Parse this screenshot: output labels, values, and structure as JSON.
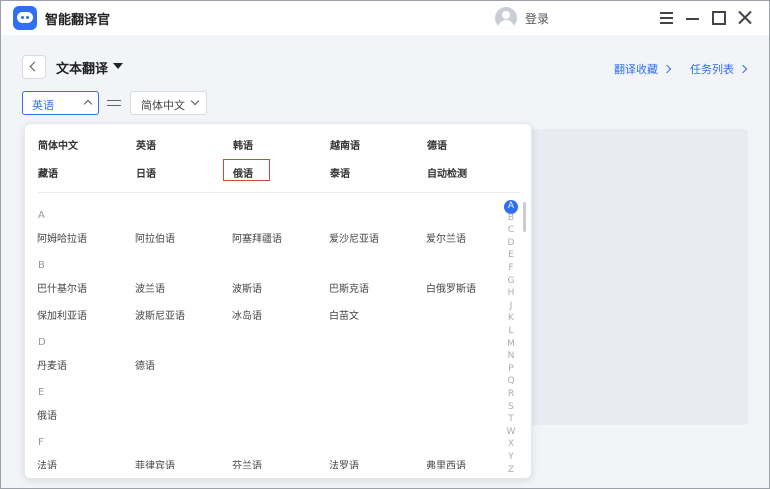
{
  "app": {
    "title": "智能翻译官",
    "login": "登录"
  },
  "header": {
    "mode": "文本翻译",
    "favorites": "翻译收藏",
    "tasks": "任务列表"
  },
  "selectors": {
    "source": "英语",
    "target": "简体中文"
  },
  "dropdown": {
    "common": [
      "简体中文",
      "英语",
      "韩语",
      "越南语",
      "德语",
      "藏语",
      "日语",
      "俄语",
      "泰语",
      "自动检测"
    ],
    "selected": "俄语",
    "groups": [
      {
        "letter": "A",
        "items": [
          "阿姆哈拉语",
          "阿拉伯语",
          "阿塞拜疆语",
          "爱沙尼亚语",
          "爱尔兰语"
        ]
      },
      {
        "letter": "B",
        "items": [
          "巴什基尔语",
          "波兰语",
          "波斯语",
          "巴斯克语",
          "白俄罗斯语",
          "保加利亚语",
          "波斯尼亚语",
          "冰岛语",
          "白苗文"
        ]
      },
      {
        "letter": "D",
        "items": [
          "丹麦语",
          "德语"
        ]
      },
      {
        "letter": "E",
        "items": [
          "俄语"
        ]
      },
      {
        "letter": "F",
        "items": [
          "法语",
          "菲律宾语",
          "芬兰语",
          "法罗语",
          "弗里西语"
        ]
      }
    ],
    "alphabet": [
      "A",
      "B",
      "C",
      "D",
      "E",
      "F",
      "G",
      "H",
      "J",
      "K",
      "L",
      "M",
      "N",
      "P",
      "Q",
      "R",
      "S",
      "T",
      "W",
      "X",
      "Y",
      "Z"
    ],
    "active_letter": "A"
  },
  "colors": {
    "accent": "#2f6ff0",
    "highlight": "#d9453a"
  }
}
